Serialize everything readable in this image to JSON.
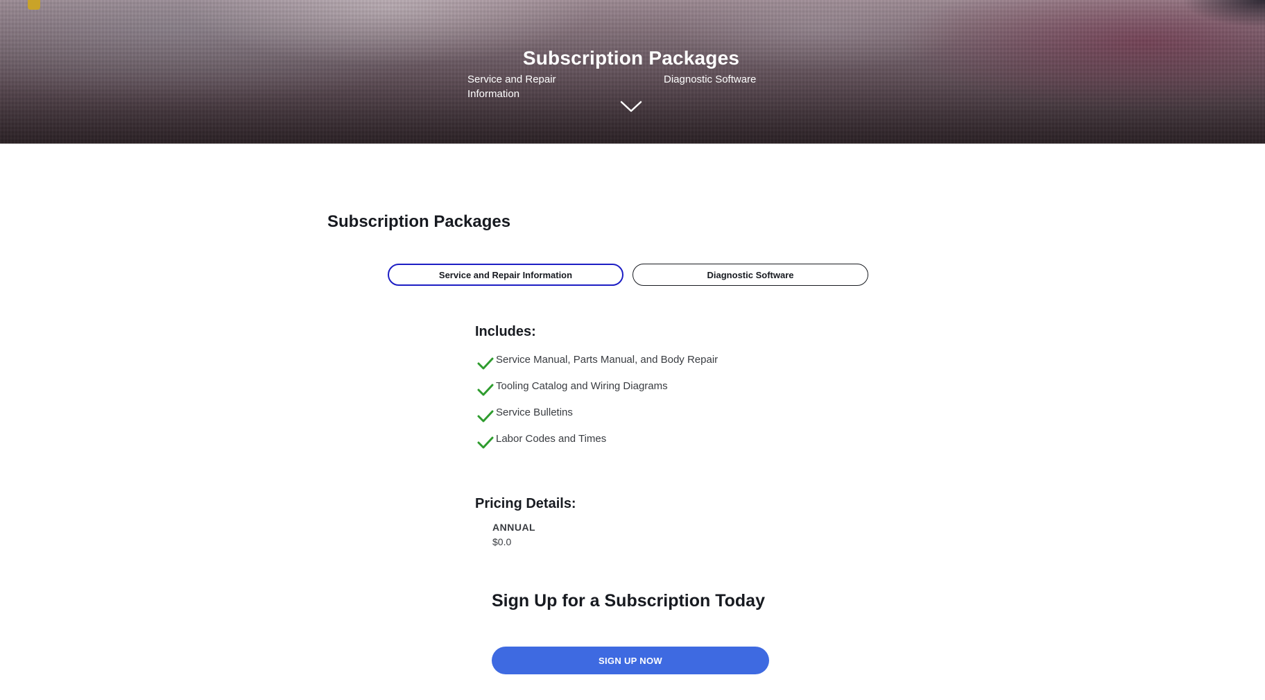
{
  "hero": {
    "title": "Subscription Packages",
    "links": [
      {
        "label": "Service and Repair Information"
      },
      {
        "label": "Diagnostic Software"
      }
    ],
    "scroll_icon": "chevron-down-icon"
  },
  "main": {
    "title": "Subscription Packages",
    "tabs": [
      {
        "label": "Service and Repair Information",
        "active": true
      },
      {
        "label": "Diagnostic Software",
        "active": false
      }
    ],
    "includes": {
      "heading": "Includes:",
      "icon": "check-icon",
      "items": [
        "Service Manual, Parts Manual, and Body Repair",
        "Tooling Catalog and Wiring Diagrams",
        "Service Bulletins",
        "Labor Codes and Times"
      ]
    },
    "pricing": {
      "heading": "Pricing Details:",
      "plan": "ANNUAL",
      "price": "$0.0"
    },
    "signup": {
      "heading": "Sign Up for a Subscription Today",
      "button_label": "SIGN UP NOW"
    }
  },
  "colors": {
    "accent_blue": "#3e6ae1",
    "active_tab_border": "#1c1dc4",
    "check_green": "#2e9c2e",
    "text_dark": "#171a20"
  }
}
